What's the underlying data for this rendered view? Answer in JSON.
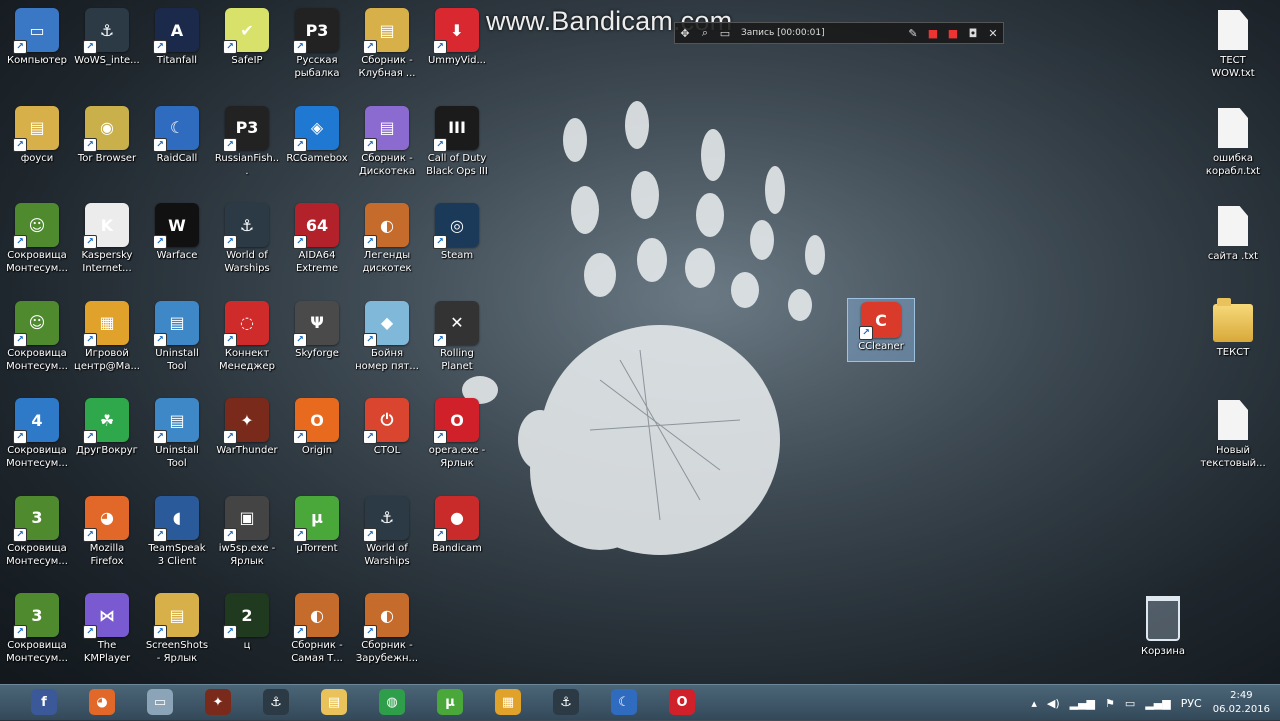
{
  "watermark": "www.Bandicam.com",
  "recorder": {
    "status": "Запись [00:00:01]"
  },
  "icons": [
    {
      "label": "Компьютер",
      "col": 0,
      "row": 0,
      "color": "#3a77c5",
      "glyph": "▭"
    },
    {
      "label": "WoWS_inte...",
      "col": 1,
      "row": 0,
      "color": "#2b3a44",
      "glyph": "⚓"
    },
    {
      "label": "Titanfall",
      "col": 2,
      "row": 0,
      "color": "#1b2a4a",
      "glyph": "A"
    },
    {
      "label": "SafeIP",
      "col": 3,
      "row": 0,
      "color": "#d8e26a",
      "glyph": "✔"
    },
    {
      "label": "Русская рыбалка",
      "col": 4,
      "row": 0,
      "color": "#222",
      "glyph": "P3"
    },
    {
      "label": "Сборник - Клубная ...",
      "col": 5,
      "row": 0,
      "color": "#d8b04a",
      "glyph": "▤"
    },
    {
      "label": "UmmyVid...",
      "col": 6,
      "row": 0,
      "color": "#d9282f",
      "glyph": "⬇"
    },
    {
      "label": "фоуси",
      "col": 0,
      "row": 1,
      "color": "#d8b04a",
      "glyph": "▤"
    },
    {
      "label": "Tor Browser",
      "col": 1,
      "row": 1,
      "color": "#c9b04a",
      "glyph": "◉"
    },
    {
      "label": "RaidCall",
      "col": 2,
      "row": 1,
      "color": "#2f6cc0",
      "glyph": "☾"
    },
    {
      "label": "RussianFish...",
      "col": 3,
      "row": 1,
      "color": "#222",
      "glyph": "P3"
    },
    {
      "label": "RCGamebox",
      "col": 4,
      "row": 1,
      "color": "#1f78d1",
      "glyph": "◈"
    },
    {
      "label": "Сборник - Дискотека ...",
      "col": 5,
      "row": 1,
      "color": "#8c6bd1",
      "glyph": "▤"
    },
    {
      "label": "Call of Duty Black Ops III",
      "col": 6,
      "row": 1,
      "color": "#1b1b1b",
      "glyph": "III"
    },
    {
      "label": "Сокровища Монтесум...",
      "col": 0,
      "row": 2,
      "color": "#4f8a2f",
      "glyph": "☺"
    },
    {
      "label": "Kaspersky Internet...",
      "col": 1,
      "row": 2,
      "color": "#ececec",
      "glyph": "K"
    },
    {
      "label": "Warface",
      "col": 2,
      "row": 2,
      "color": "#111",
      "glyph": "W"
    },
    {
      "label": "World of Warships",
      "col": 3,
      "row": 2,
      "color": "#2b3a44",
      "glyph": "⚓"
    },
    {
      "label": "AIDA64 Extreme",
      "col": 4,
      "row": 2,
      "color": "#b3222a",
      "glyph": "64"
    },
    {
      "label": "Легенды дискотек 8...",
      "col": 5,
      "row": 2,
      "color": "#c56c2c",
      "glyph": "◐"
    },
    {
      "label": "Steam",
      "col": 6,
      "row": 2,
      "color": "#1b3a5a",
      "glyph": "◎"
    },
    {
      "label": "Сокровища Монтесум...",
      "col": 0,
      "row": 3,
      "color": "#4f8a2f",
      "glyph": "☺"
    },
    {
      "label": "Игровой центр@Ma...",
      "col": 1,
      "row": 3,
      "color": "#e0a22b",
      "glyph": "▦"
    },
    {
      "label": "Uninstall Tool",
      "col": 2,
      "row": 3,
      "color": "#3f88c8",
      "glyph": "▤"
    },
    {
      "label": "Коннект Менеджер",
      "col": 3,
      "row": 3,
      "color": "#cf2b2b",
      "glyph": "◌"
    },
    {
      "label": "Skyforge",
      "col": 4,
      "row": 3,
      "color": "#4a4a4a",
      "glyph": "Ψ"
    },
    {
      "label": "Бойня номер пят...",
      "col": 5,
      "row": 3,
      "color": "#7fb8d8",
      "glyph": "◆"
    },
    {
      "label": "Rolling Planet",
      "col": 6,
      "row": 3,
      "color": "#333",
      "glyph": "✕"
    },
    {
      "label": "Сокровища Монтесум...",
      "col": 0,
      "row": 4,
      "color": "#2f7ac8",
      "glyph": "4"
    },
    {
      "label": "ДругВокруг",
      "col": 1,
      "row": 4,
      "color": "#2ea84a",
      "glyph": "☘"
    },
    {
      "label": "Uninstall Tool",
      "col": 2,
      "row": 4,
      "color": "#3f88c8",
      "glyph": "▤"
    },
    {
      "label": "WarThunder",
      "col": 3,
      "row": 4,
      "color": "#7a2a1a",
      "glyph": "✦"
    },
    {
      "label": "Origin",
      "col": 4,
      "row": 4,
      "color": "#e86a1f",
      "glyph": "O"
    },
    {
      "label": "CTOL",
      "col": 5,
      "row": 4,
      "color": "#d9452f",
      "glyph": "⏻"
    },
    {
      "label": "opera.exe - Ярлык",
      "col": 6,
      "row": 4,
      "color": "#d0202a",
      "glyph": "O"
    },
    {
      "label": "Сокровища Монтесум...",
      "col": 0,
      "row": 5,
      "color": "#4f8a2f",
      "glyph": "3"
    },
    {
      "label": "Mozilla Firefox",
      "col": 1,
      "row": 5,
      "color": "#e2682a",
      "glyph": "◕"
    },
    {
      "label": "TeamSpeak 3 Client",
      "col": 2,
      "row": 5,
      "color": "#2a5a9a",
      "glyph": "◖"
    },
    {
      "label": "iw5sp.exe - Ярлык",
      "col": 3,
      "row": 5,
      "color": "#444",
      "glyph": "▣"
    },
    {
      "label": "µTorrent",
      "col": 4,
      "row": 5,
      "color": "#4aa83a",
      "glyph": "µ"
    },
    {
      "label": "World of Warships",
      "col": 5,
      "row": 5,
      "color": "#2b3a44",
      "glyph": "⚓"
    },
    {
      "label": "Bandicam",
      "col": 6,
      "row": 5,
      "color": "#c92a2a",
      "glyph": "●"
    },
    {
      "label": "Сокровища Монтесум...",
      "col": 0,
      "row": 6,
      "color": "#4f8a2f",
      "glyph": "3"
    },
    {
      "label": "The KMPlayer",
      "col": 1,
      "row": 6,
      "color": "#7a5ad0",
      "glyph": "⋈"
    },
    {
      "label": "ScreenShots - Ярлык",
      "col": 2,
      "row": 6,
      "color": "#d8b04a",
      "glyph": "▤"
    },
    {
      "label": "ц",
      "col": 3,
      "row": 6,
      "color": "#1f3a1f",
      "glyph": "2"
    },
    {
      "label": "Сборник - Самая Т...",
      "col": 4,
      "row": 6,
      "color": "#c56c2c",
      "glyph": "◐"
    },
    {
      "label": "Сборник - Зарубежн...",
      "col": 5,
      "row": 6,
      "color": "#c56c2c",
      "glyph": "◐"
    }
  ],
  "floating_icon": {
    "label": "CCleaner",
    "color": "#d93a2a",
    "glyph": "C"
  },
  "right_icons": [
    {
      "label": "ТЕСТ WOW.txt",
      "type": "file"
    },
    {
      "label": "ошибка корабл.txt",
      "type": "file"
    },
    {
      "label": "сайта .txt",
      "type": "file"
    },
    {
      "label": "ТЕКСТ",
      "type": "folder"
    },
    {
      "label": "Новый текстовый...",
      "type": "file"
    }
  ],
  "recycle_bin": {
    "label": "Корзина"
  },
  "taskbar": {
    "apps": [
      {
        "name": "tb-facebook",
        "color": "#3b5998",
        "glyph": "f"
      },
      {
        "name": "tb-firefox",
        "color": "#e2682a",
        "glyph": "◕"
      },
      {
        "name": "tb-explorer-window",
        "color": "#8ca4b8",
        "glyph": "▭"
      },
      {
        "name": "tb-warthunder",
        "color": "#7a2a1a",
        "glyph": "✦"
      },
      {
        "name": "tb-warships",
        "color": "#2b3a44",
        "glyph": "⚓"
      },
      {
        "name": "tb-file-explorer",
        "color": "#e9c25b",
        "glyph": "▤"
      },
      {
        "name": "tb-chrome",
        "color": "#2f9e4a",
        "glyph": "◍"
      },
      {
        "name": "tb-utorrent",
        "color": "#4aa83a",
        "glyph": "µ"
      },
      {
        "name": "tb-game-center",
        "color": "#e0a22b",
        "glyph": "▦"
      },
      {
        "name": "tb-warships-2",
        "color": "#2b3a44",
        "glyph": "⚓"
      },
      {
        "name": "tb-raidcall",
        "color": "#2f6cc0",
        "glyph": "☾"
      },
      {
        "name": "tb-opera",
        "color": "#d0202a",
        "glyph": "O"
      }
    ],
    "language": "РУС",
    "time": "2:49",
    "date": "06.02.2016"
  }
}
